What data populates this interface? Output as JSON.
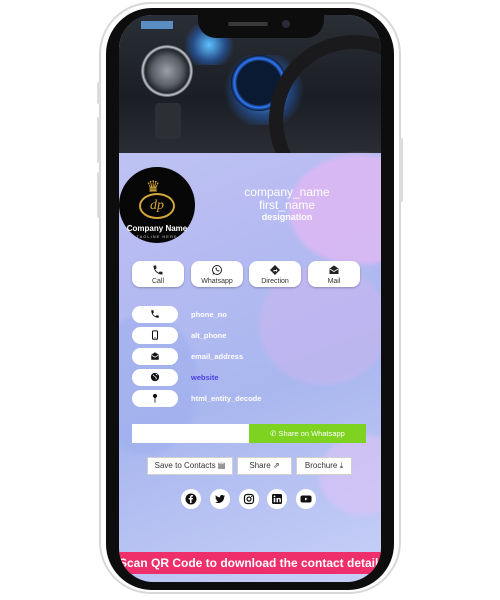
{
  "colors": {
    "screen_bg": "#b8bcf2",
    "accent_whatsapp": "#7ed321",
    "qr_bar": "#ef2f6b",
    "logo_gold": "#d4a73a"
  },
  "logo": {
    "monogram": "dp",
    "name": "Company Name",
    "tagline": "TAGLINE HERE"
  },
  "profile": {
    "company_name": "company_name",
    "first_name": "first_name",
    "designation": "designation"
  },
  "actions": [
    {
      "label": "Call",
      "icon": "phone-icon"
    },
    {
      "label": "Whatsapp",
      "icon": "whatsapp-icon"
    },
    {
      "label": "Direction",
      "icon": "direction-icon"
    },
    {
      "label": "Mail",
      "icon": "mail-icon"
    }
  ],
  "contacts": [
    {
      "value": "phone_no",
      "icon": "phone-icon"
    },
    {
      "value": "alt_phone",
      "icon": "mobile-icon"
    },
    {
      "value": "email_address",
      "icon": "envelope-icon"
    },
    {
      "value": "website",
      "icon": "globe-icon"
    },
    {
      "value": "html_entity_decode",
      "icon": "map-pin-icon"
    }
  ],
  "whatsapp_share": {
    "placeholder": "",
    "button_label": "Share on Whatsapp"
  },
  "buttons": {
    "save_contacts": "Save to Contacts",
    "share": "Share",
    "brochure": "Brochure"
  },
  "social": [
    "facebook-icon",
    "twitter-icon",
    "instagram-icon",
    "linkedin-icon",
    "youtube-icon"
  ],
  "qr_banner": "Scan QR Code to download the contact details"
}
